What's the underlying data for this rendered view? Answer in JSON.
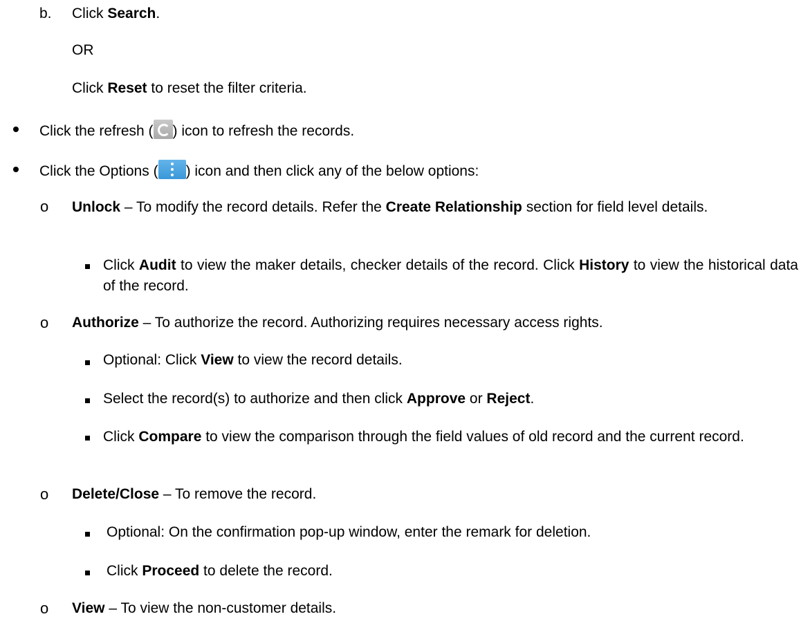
{
  "step_b": {
    "marker": "b.",
    "pre": "Click ",
    "bold": "Search",
    "post": "."
  },
  "or_text": "OR",
  "reset": {
    "pre": "Click ",
    "bold": "Reset",
    "post": " to reset the filter criteria."
  },
  "refresh_item": {
    "pre": "Click the refresh (",
    "icon": "refresh-icon",
    "post": ") icon to refresh the records."
  },
  "options_item": {
    "pre": "Click the Options (",
    "icon": "options-icon",
    "post": ") icon and then click any of the below options:"
  },
  "unlock": {
    "bold": "Unlock",
    "text1": " – To modify the record details. Refer the ",
    "bold2": "Create Relationship",
    "text2": " section for field level details."
  },
  "audit": {
    "pre": "Click ",
    "bold": "Audit",
    "mid": " to view the maker details, checker details of the record. Click ",
    "bold2": "History",
    "post": " to view the historical data of the record."
  },
  "authorize": {
    "bold": "Authorize",
    "text": " – To authorize the record. Authorizing requires necessary access rights."
  },
  "auth_view": {
    "pre": "Optional: Click ",
    "bold": "View",
    "post": " to view the record details."
  },
  "auth_select": {
    "pre": "Select the record(s) to authorize and then click ",
    "bold": "Approve",
    "mid": " or ",
    "bold2": "Reject",
    "post": "."
  },
  "compare": {
    "pre": "Click ",
    "bold": "Compare",
    "post": " to view the comparison through the field values of old record and the current record."
  },
  "delete": {
    "bold": "Delete/Close",
    "text": " – To remove the record."
  },
  "delete_optional": "Optional: On the confirmation pop-up window, enter the remark for deletion.",
  "proceed": {
    "pre": "Click ",
    "bold": "Proceed",
    "post": " to delete the record."
  },
  "view": {
    "bold": "View",
    "text": " – To view the non-customer details."
  }
}
